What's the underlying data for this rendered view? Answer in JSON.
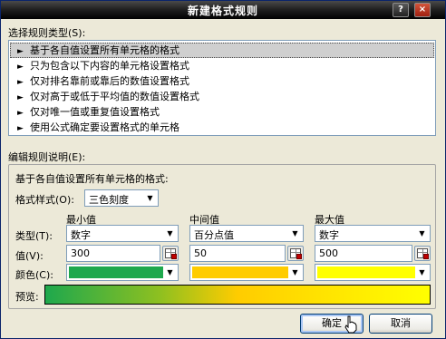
{
  "dialog": {
    "title": "新建格式规则",
    "help_label": "?",
    "close_label": "×"
  },
  "rule_type": {
    "label": "选择规则类型(S):",
    "items": [
      "基于各自值设置所有单元格的格式",
      "只为包含以下内容的单元格设置格式",
      "仅对排名靠前或靠后的数值设置格式",
      "仅对高于或低于平均值的数值设置格式",
      "仅对唯一值或重复值设置格式",
      "使用公式确定要设置格式的单元格"
    ],
    "selected_index": 0,
    "arrow_glyph": "►"
  },
  "edit": {
    "label": "编辑规则说明(E):",
    "heading": "基于各自值设置所有单元格的格式:",
    "format_style_label": "格式样式(O):",
    "format_style_value": "三色刻度",
    "columns": {
      "min": "最小值",
      "mid": "中间值",
      "max": "最大值"
    },
    "row_labels": {
      "type": "类型(T):",
      "value": "值(V):",
      "color": "颜色(C):"
    },
    "min": {
      "type": "数字",
      "value": "300",
      "color": "#1ea84d"
    },
    "mid": {
      "type": "百分点值",
      "value": "50",
      "color": "#ffcc00"
    },
    "max": {
      "type": "数字",
      "value": "500",
      "color": "#ffff00"
    },
    "preview_label": "预览:"
  },
  "buttons": {
    "ok": "确定",
    "cancel": "取消"
  }
}
